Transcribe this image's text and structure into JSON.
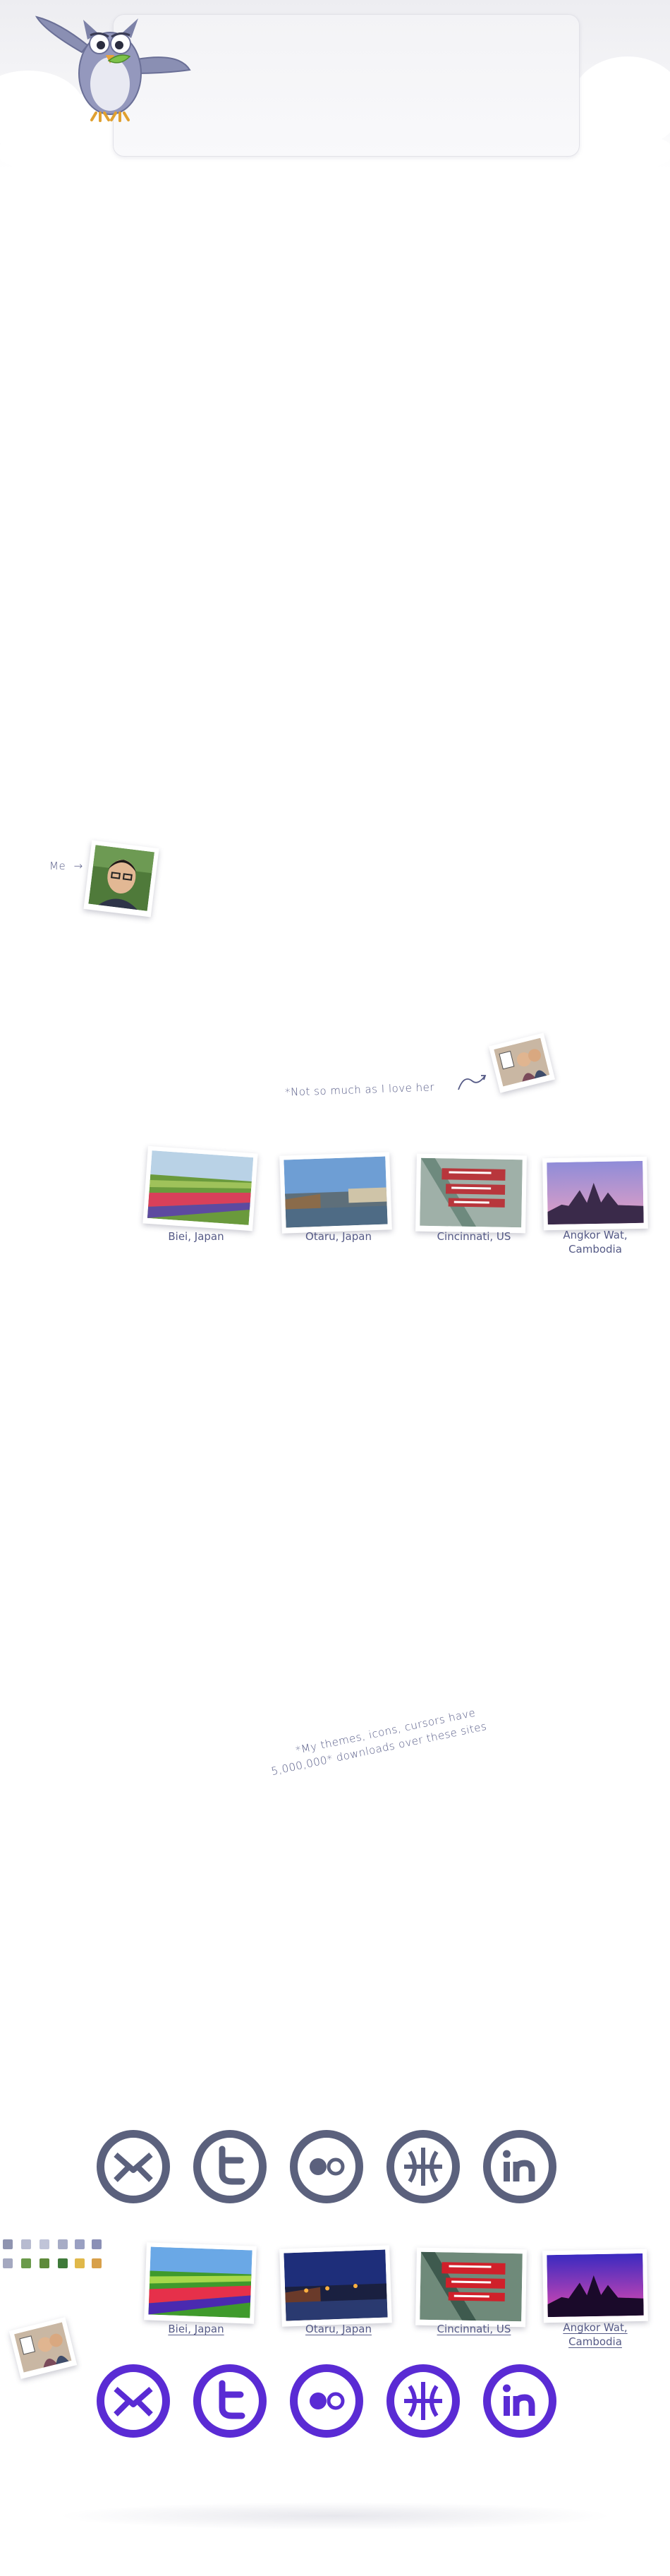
{
  "me": {
    "label": "Me",
    "arrow": "→"
  },
  "love_note": {
    "text": "*Not so much as I love her"
  },
  "places_top": [
    {
      "name": "Biei, Japan"
    },
    {
      "name": "Otaru, Japan"
    },
    {
      "name": "Cincinnati, US"
    },
    {
      "name": "Angkor Wat,",
      "name2": "Cambodia"
    }
  ],
  "downloads_note": {
    "line1": "*My themes, icons, cursors have",
    "line2": "5,000,000* downloads over these sites"
  },
  "social_icons": [
    {
      "icon": "envelope-icon"
    },
    {
      "icon": "twitter-icon"
    },
    {
      "icon": "flickr-icon"
    },
    {
      "icon": "dribbble-icon"
    },
    {
      "icon": "linkedin-icon"
    }
  ],
  "places_bottom": [
    {
      "name": "Biei, Japan"
    },
    {
      "name": "Otaru, Japan"
    },
    {
      "name": "Cincinnati, US"
    },
    {
      "name": "Angkor Wat,",
      "name2": "Cambodia"
    }
  ],
  "colors": {
    "social_grey": "#5b617d",
    "social_purple": "#5a2bd4",
    "text": "#555a86"
  }
}
